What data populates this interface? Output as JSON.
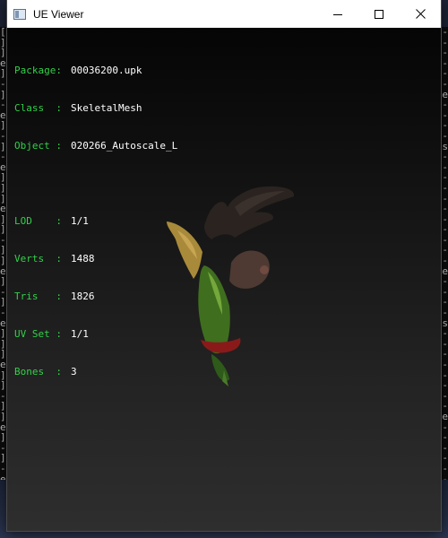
{
  "window": {
    "title": "UE Viewer",
    "minimize_icon": "minimize-icon",
    "maximize_icon": "maximize-icon",
    "close_icon": "close-icon"
  },
  "info": {
    "package_label": "Package:",
    "package_value": "00036200.upk",
    "class_label": "Class  :",
    "class_value": "SkeletalMesh",
    "object_label": "Object :",
    "object_value": "020266_Autoscale_L",
    "lod_label": "LOD    :",
    "lod_value": "1/1",
    "verts_label": "Verts  :",
    "verts_value": "1488",
    "tris_label": "Tris   :",
    "tris_value": "1826",
    "uvset_label": "UV Set :",
    "uvset_value": "1/1",
    "bones_label": "Bones  :",
    "bones_value": "3"
  },
  "background_console": {
    "left_chars": "[]]e]-]-e]-]-e]]]e]]-]]e]-]-e]]]e]]-]]e]-]-e]-]-",
    "right_chars": "------e----s-----------e----s--------e------",
    "colors": {
      "background": "#0c0c0c",
      "text": "#c8c8c8"
    }
  },
  "colors": {
    "label_green": "#33d04a",
    "value_white": "#ffffff",
    "titlebar": "#ffffff"
  }
}
